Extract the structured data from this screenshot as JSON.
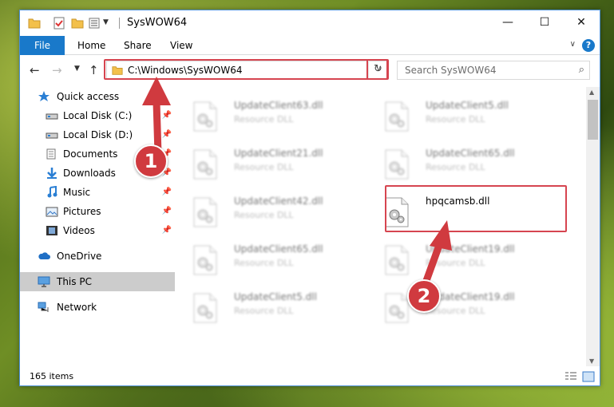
{
  "window": {
    "title": "SysWOW64",
    "min_glyph": "—",
    "max_glyph": "☐",
    "close_glyph": "✕"
  },
  "ribbon": {
    "tabs": [
      "File",
      "Home",
      "Share",
      "View"
    ],
    "help": "?"
  },
  "nav": {
    "address": "C:\\Windows\\SysWOW64",
    "search_placeholder": "Search SysWOW64"
  },
  "sidebar": {
    "items": [
      {
        "label": "Quick access",
        "icon": "star-icon",
        "level": 0
      },
      {
        "label": "Local Disk (C:)",
        "icon": "drive-icon",
        "level": 1,
        "pinned": true
      },
      {
        "label": "Local Disk (D:)",
        "icon": "drive-icon",
        "level": 1,
        "pinned": true
      },
      {
        "label": "Documents",
        "icon": "documents-icon",
        "level": 1,
        "pinned": true
      },
      {
        "label": "Downloads",
        "icon": "download-icon",
        "level": 1,
        "pinned": true
      },
      {
        "label": "Music",
        "icon": "music-icon",
        "level": 1,
        "pinned": true
      },
      {
        "label": "Pictures",
        "icon": "pictures-icon",
        "level": 1,
        "pinned": true
      },
      {
        "label": "Videos",
        "icon": "videos-icon",
        "level": 1,
        "pinned": true
      },
      {
        "label": "OneDrive",
        "icon": "cloud-icon",
        "level": 0
      },
      {
        "label": "This PC",
        "icon": "computer-icon",
        "level": 0,
        "selected": true
      },
      {
        "label": "Network",
        "icon": "network-icon",
        "level": 0
      }
    ]
  },
  "files": [
    {
      "name": "UpdateClient63.dll",
      "type": "Resource DLL",
      "blurred": true
    },
    {
      "name": "UpdateClient5.dll",
      "type": "Resource DLL",
      "blurred": true
    },
    {
      "name": "UpdateClient21.dll",
      "type": "Resource DLL",
      "blurred": true
    },
    {
      "name": "UpdateClient65.dll",
      "type": "Resource DLL",
      "blurred": true
    },
    {
      "name": "UpdateClient42.dll",
      "type": "Resource DLL",
      "blurred": true
    },
    {
      "name": "hpqcamsb.dll",
      "type": "",
      "blurred": false
    },
    {
      "name": "UpdateClient65.dll",
      "type": "Resource DLL",
      "blurred": true
    },
    {
      "name": "UpdateClient19.dll",
      "type": "Resource DLL",
      "blurred": true
    },
    {
      "name": "UpdateClient5.dll",
      "type": "Resource DLL",
      "blurred": true
    },
    {
      "name": "UpdateClient19.dll",
      "type": "Resource DLL",
      "blurred": true
    }
  ],
  "status": {
    "count": "165 items"
  },
  "annotations": {
    "step1": "1",
    "step2": "2",
    "color": "#d03a3f"
  }
}
